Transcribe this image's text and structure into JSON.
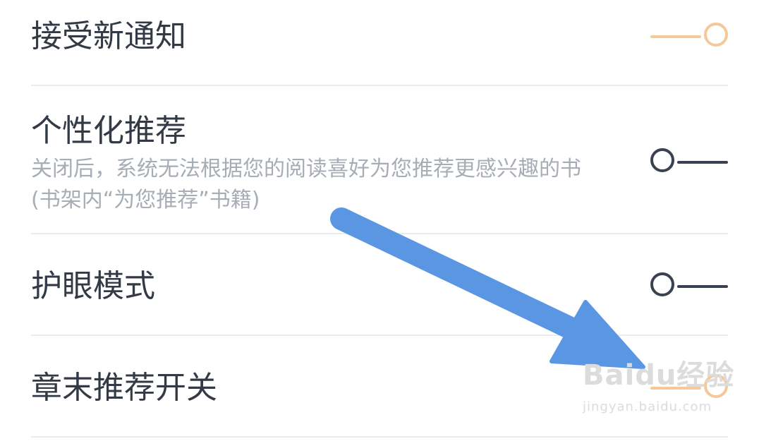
{
  "settings": [
    {
      "title": "接受新通知",
      "description": "",
      "enabled": true
    },
    {
      "title": "个性化推荐",
      "description": "关闭后，系统无法根据您的阅读喜好为您推荐更感兴趣的书(书架内“为您推荐”书籍)",
      "enabled": false
    },
    {
      "title": "护眼模式",
      "description": "",
      "enabled": false
    },
    {
      "title": "章末推荐开关",
      "description": "",
      "enabled": true
    }
  ],
  "colors": {
    "toggle_on": "#f5c89a",
    "toggle_off": "#3a4150",
    "annotation_arrow": "#5b96e3"
  },
  "watermark": {
    "main": "Baidu经验",
    "sub": "jingyan.baidu.com"
  }
}
